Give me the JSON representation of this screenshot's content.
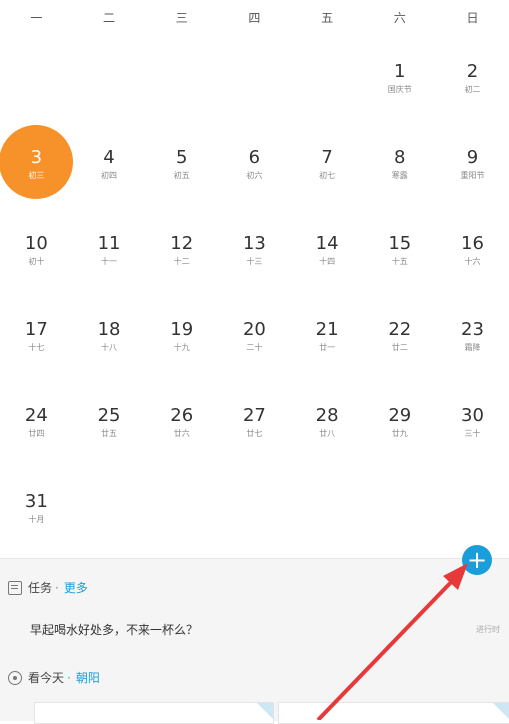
{
  "weekdays": [
    "一",
    "二",
    "三",
    "四",
    "五",
    "六",
    "日"
  ],
  "days": [
    {
      "day": "1",
      "lunar": "国庆节"
    },
    {
      "day": "2",
      "lunar": "初二"
    },
    {
      "day": "3",
      "lunar": "初三"
    },
    {
      "day": "4",
      "lunar": "初四"
    },
    {
      "day": "5",
      "lunar": "初五"
    },
    {
      "day": "6",
      "lunar": "初六"
    },
    {
      "day": "7",
      "lunar": "初七"
    },
    {
      "day": "8",
      "lunar": "寒露"
    },
    {
      "day": "9",
      "lunar": "重阳节"
    },
    {
      "day": "10",
      "lunar": "初十"
    },
    {
      "day": "11",
      "lunar": "十一"
    },
    {
      "day": "12",
      "lunar": "十二"
    },
    {
      "day": "13",
      "lunar": "十三"
    },
    {
      "day": "14",
      "lunar": "十四"
    },
    {
      "day": "15",
      "lunar": "十五"
    },
    {
      "day": "16",
      "lunar": "十六"
    },
    {
      "day": "17",
      "lunar": "十七"
    },
    {
      "day": "18",
      "lunar": "十八"
    },
    {
      "day": "19",
      "lunar": "十九"
    },
    {
      "day": "20",
      "lunar": "二十"
    },
    {
      "day": "21",
      "lunar": "廿一"
    },
    {
      "day": "22",
      "lunar": "廿二"
    },
    {
      "day": "23",
      "lunar": "霜降"
    },
    {
      "day": "24",
      "lunar": "廿四"
    },
    {
      "day": "25",
      "lunar": "廿五"
    },
    {
      "day": "26",
      "lunar": "廿六"
    },
    {
      "day": "27",
      "lunar": "廿七"
    },
    {
      "day": "28",
      "lunar": "廿八"
    },
    {
      "day": "29",
      "lunar": "廿九"
    },
    {
      "day": "30",
      "lunar": "三十"
    },
    {
      "day": "31",
      "lunar": "十月"
    }
  ],
  "selected_day": "3",
  "tasks": {
    "label": "任务",
    "separator": "·",
    "more_link": "更多",
    "item_text": "早起喝水好处多，不来一杯么？",
    "item_status": "进行时"
  },
  "today": {
    "label": "看今天",
    "separator": "·",
    "location": "朝阳"
  },
  "fab": {
    "symbol": "+"
  },
  "colors": {
    "accent": "#1a9edb",
    "selected": "#f7922a",
    "arrow": "#e63a3a"
  }
}
